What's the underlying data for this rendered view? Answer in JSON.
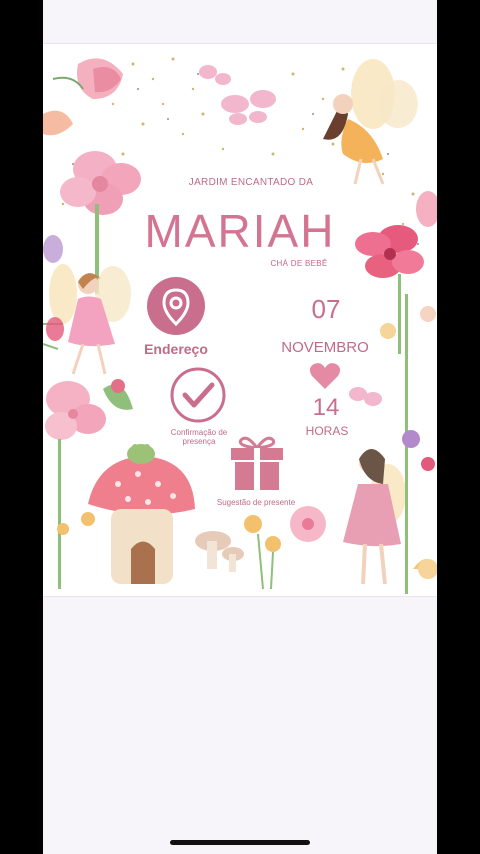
{
  "invitation": {
    "header": "JARDIM ENCANTADO DA",
    "name": "MARIAH",
    "event_type": "CHÁ DE BEBÊ",
    "address_label": "Endereço",
    "rsvp_label": "Confirmação de presença",
    "gift_label": "Sugestão de presente",
    "day": "07",
    "month": "NOVEMBRO",
    "hour": "14",
    "hour_unit": "HORAS"
  },
  "colors": {
    "accent": "#c06b86",
    "name_pink": "#d37592",
    "background": "#ffffff",
    "screen_bg": "#f7f5fa"
  },
  "icons": [
    "location-pin-icon",
    "checkmark-icon",
    "gift-icon",
    "heart-icon"
  ]
}
